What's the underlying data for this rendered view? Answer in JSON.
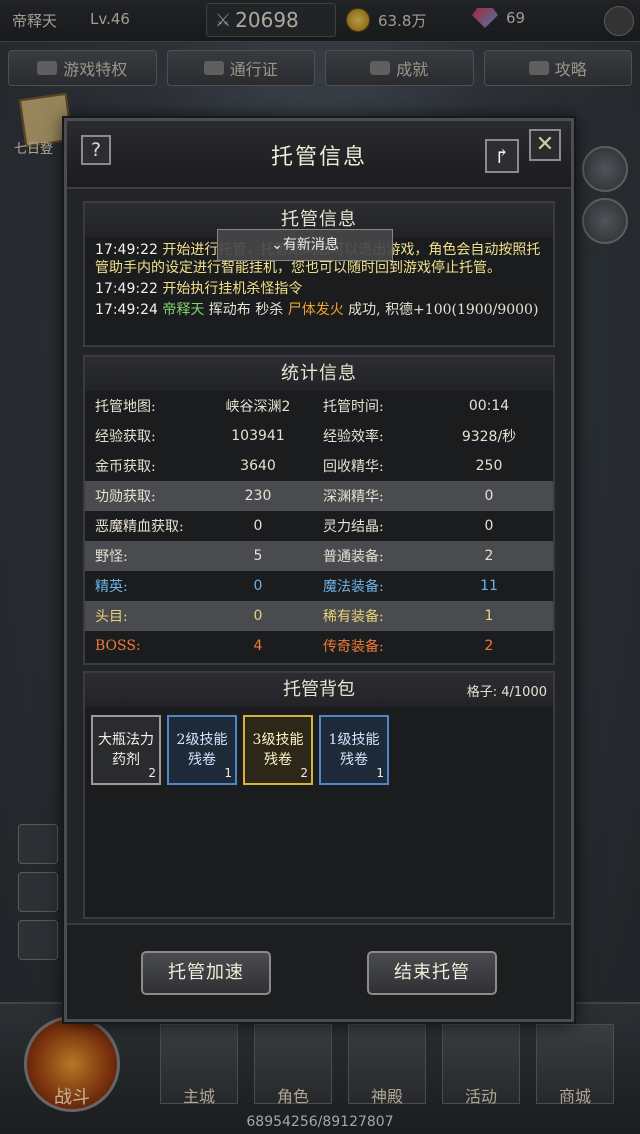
{
  "top": {
    "player_name": "帝释天",
    "level": "Lv.46",
    "power": "20698",
    "gold": "63.8万",
    "gems": "69"
  },
  "nav": {
    "tabs": [
      "游戏特权",
      "通行证",
      "成就",
      "攻略"
    ]
  },
  "side_left": {
    "label": "七日登"
  },
  "bottom": {
    "battle_label": "战斗",
    "buttons": [
      "主城",
      "角色",
      "神殿",
      "活动",
      "商城"
    ],
    "exp_text": "68954256/89127807"
  },
  "modal": {
    "title": "托管信息",
    "help_label": "?",
    "share_label": "↱",
    "close_label": "✕",
    "log": {
      "title": "托管信息",
      "lines": [
        {
          "time": "17:49:22",
          "text": "开始进行托管，托管期间您可以退出游戏，角色会自动按照托管助手内的设定进行智能挂机，您也可以随时回到游戏停止托管。"
        },
        {
          "time": "17:49:22",
          "text": "开始执行挂机杀怪指令"
        },
        {
          "time": "17:49:24",
          "name": "帝释天",
          "text1": "挥动布",
          "text2": "秒杀",
          "target": "尸体发火",
          "text3": "成功,",
          "text4": "积德+100(1900/9000)"
        }
      ],
      "new_message_label": "⌄有新消息"
    },
    "stats": {
      "title": "统计信息",
      "rows": [
        {
          "l1": "托管地图:",
          "v1": "峡谷深渊2",
          "l2": "托管时间:",
          "v2": "00:14"
        },
        {
          "l1": "经验获取:",
          "v1": "103941",
          "l2": "经验效率:",
          "v2": "9328/秒"
        },
        {
          "l1": "金币获取:",
          "v1": "3640",
          "l2": "回收精华:",
          "v2": "250"
        },
        {
          "l1": "功勋获取:",
          "v1": "230",
          "l2": "深渊精华:",
          "v2": "0"
        },
        {
          "l1": "恶魔精血获取:",
          "v1": "0",
          "l2": "灵力结晶:",
          "v2": "0"
        },
        {
          "l1": "野怪:",
          "v1": "5",
          "l2": "普通装备:",
          "v2": "2"
        },
        {
          "l1": "精英:",
          "v1": "0",
          "l2": "魔法装备:",
          "v2": "11"
        },
        {
          "l1": "头目:",
          "v1": "0",
          "l2": "稀有装备:",
          "v2": "1"
        },
        {
          "l1": "BOSS:",
          "v1": "4",
          "l2": "传奇装备:",
          "v2": "2"
        }
      ]
    },
    "bag": {
      "title": "托管背包",
      "capacity": "格子: 4/1000",
      "items": [
        {
          "name": "大瓶法力药剂",
          "count": "2",
          "rarity": "common"
        },
        {
          "name": "2级技能残卷",
          "count": "1",
          "rarity": "magic"
        },
        {
          "name": "3级技能残卷",
          "count": "2",
          "rarity": "rare"
        },
        {
          "name": "1级技能残卷",
          "count": "1",
          "rarity": "magic"
        }
      ]
    },
    "buttons": {
      "speed_up": "托管加速",
      "end": "结束托管"
    }
  },
  "colors": {
    "stat_white": "#e6e0d2",
    "stat_blue": "#6db3e8",
    "stat_yellow": "#e8d27a",
    "stat_orange": "#f07a3a",
    "highlight_row": "#4a4b4e"
  }
}
